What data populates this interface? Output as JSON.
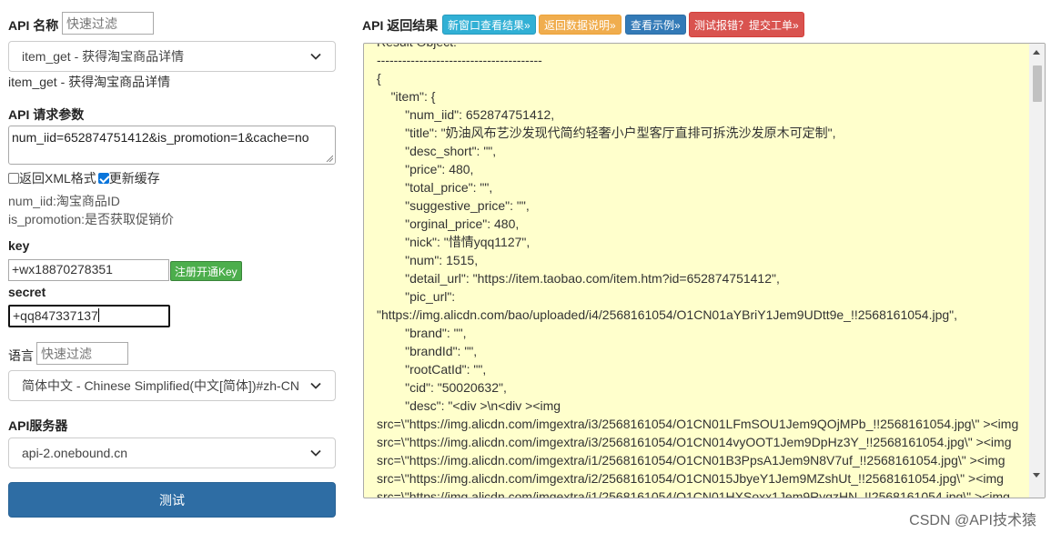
{
  "left": {
    "api_name_label": "API 名称",
    "api_filter_placeholder": "快速过滤",
    "api_select_value": "item_get - 获得淘宝商品详情",
    "api_selected_desc": "item_get - 获得淘宝商品详情",
    "params_label": "API 请求参数",
    "params_value": "num_iid=652874751412&is_promotion=1&cache=no",
    "xml_checkbox_label": "返回XML格式",
    "xml_checked": false,
    "cache_checkbox_label": "更新缓存",
    "cache_checked": true,
    "param_desc_1": "num_iid:淘宝商品ID",
    "param_desc_2": "is_promotion:是否获取促销价",
    "key_label": "key",
    "key_value": "+wx18870278351",
    "register_button": "注册开通Key",
    "secret_label": "secret",
    "secret_value": "+qq847337137",
    "lang_label": "语言",
    "lang_filter_placeholder": "快速过滤",
    "lang_select_value": "简体中文 - Chinese Simplified(中文[简体])#zh-CN",
    "server_label": "API服务器",
    "server_select_value": "api-2.onebound.cn",
    "test_button": "测试"
  },
  "right": {
    "result_label": "API 返回结果",
    "btn_new_window": "新窗口查看结果»",
    "btn_return_docs": "返回数据说明»",
    "btn_examples": "查看示例»",
    "btn_report": "测试报错？提交工单»",
    "result_text": "Result Object:\n---------------------------------------\n{\n\t\"item\": {\n\t\t\"num_iid\": 652874751412,\n\t\t\"title\": \"奶油风布艺沙发现代简约轻奢小户型客厅直排可拆洗沙发原木可定制\",\n\t\t\"desc_short\": \"\",\n\t\t\"price\": 480,\n\t\t\"total_price\": \"\",\n\t\t\"suggestive_price\": \"\",\n\t\t\"orginal_price\": 480,\n\t\t\"nick\": \"惜情yqq1127\",\n\t\t\"num\": 1515,\n\t\t\"detail_url\": \"https://item.taobao.com/item.htm?id=652874751412\",\n\t\t\"pic_url\":\n\"https://img.alicdn.com/bao/uploaded/i4/2568161054/O1CN01aYBriY1Jem9UDtt9e_!!2568161054.jpg\",\n\t\t\"brand\": \"\",\n\t\t\"brandId\": \"\",\n\t\t\"rootCatId\": \"\",\n\t\t\"cid\": \"50020632\",\n\t\t\"desc\": \"<div >\\n<div ><img\nsrc=\\\"https://img.alicdn.com/imgextra/i3/2568161054/O1CN01LFmSOU1Jem9QOjMPb_!!2568161054.jpg\\\" ><img\nsrc=\\\"https://img.alicdn.com/imgextra/i3/2568161054/O1CN014vyOOT1Jem9DpHz3Y_!!2568161054.jpg\\\" ><img\nsrc=\\\"https://img.alicdn.com/imgextra/i1/2568161054/O1CN01B3PpsA1Jem9N8V7uf_!!2568161054.jpg\\\" ><img\nsrc=\\\"https://img.alicdn.com/imgextra/i2/2568161054/O1CN015JbyeY1Jem9MZshUt_!!2568161054.jpg\\\" ><img\nsrc=\\\"https://img.alicdn.com/imgextra/i1/2568161054/O1CN01HXSoxx1Jem9RygzHN_!!2568161054.jpg\\\" ><img"
  },
  "watermark": "CSDN @API技术猿",
  "colors": {
    "result_bg": "#ffffcc",
    "test_button": "#2e6da4",
    "register_button": "#4cae4c",
    "btn_info": "#31b0d5",
    "btn_warning": "#f0ad4e",
    "btn_primary": "#337ab7",
    "btn_danger": "#d9534f"
  },
  "icons": [
    "chevron-down-icon",
    "checkbox-icon",
    "resize-handle-icon",
    "scroll-up-icon",
    "scroll-down-icon"
  ]
}
